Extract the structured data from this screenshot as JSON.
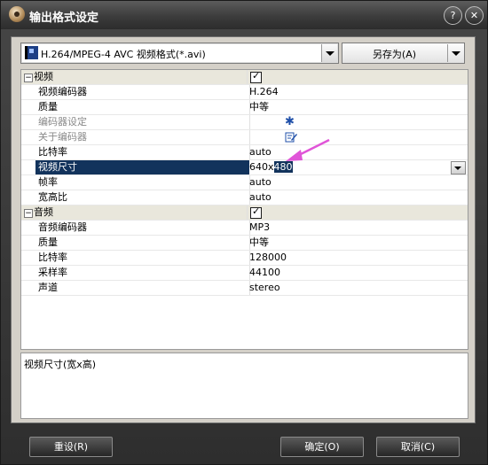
{
  "window": {
    "title": "输出格式设定"
  },
  "top": {
    "format": "H.264/MPEG-4 AVC 视频格式(*.avi)",
    "saveas": "另存为(A)"
  },
  "grid": {
    "video": {
      "label": "视频",
      "rows": [
        {
          "name": "视频编码器",
          "value": "H.264"
        },
        {
          "name": "质量",
          "value": "中等"
        },
        {
          "name": "编码器设定",
          "value": ""
        },
        {
          "name": "关于编码器",
          "value": ""
        },
        {
          "name": "比特率",
          "value": "auto"
        },
        {
          "name": "视频尺寸",
          "value_prefix": "640x",
          "value_selected": "480"
        },
        {
          "name": "帧率",
          "value": "auto"
        },
        {
          "name": "宽高比",
          "value": "auto"
        }
      ]
    },
    "audio": {
      "label": "音频",
      "rows": [
        {
          "name": "音频编码器",
          "value": "MP3"
        },
        {
          "name": "质量",
          "value": "中等"
        },
        {
          "name": "比特率",
          "value": "128000"
        },
        {
          "name": "采样率",
          "value": "44100"
        },
        {
          "name": "声道",
          "value": "stereo"
        }
      ]
    }
  },
  "description": "视频尺寸(宽x高)",
  "buttons": {
    "reset": "重设(R)",
    "ok": "确定(O)",
    "cancel": "取消(C)"
  },
  "colors": {
    "selection": "#12335c",
    "annotation_arrow": "#e055d8"
  }
}
